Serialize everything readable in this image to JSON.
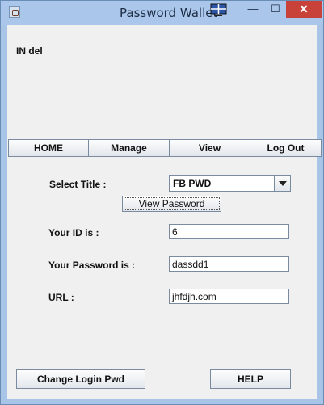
{
  "window": {
    "title": "Password Wallet",
    "controls": {
      "minimize": "—",
      "maximize": "☐",
      "close": "✕"
    }
  },
  "header": {
    "text": "IN del"
  },
  "menu": [
    {
      "label": "HOME"
    },
    {
      "label": "Manage"
    },
    {
      "label": "View"
    },
    {
      "label": "Log Out"
    }
  ],
  "form": {
    "select_title_label": "Select Title :",
    "select_title_value": "FB PWD",
    "view_password_button": "View Password",
    "id_label": "Your ID is :",
    "id_value": "6",
    "password_label": "Your Password is :",
    "password_value": "dassdd1",
    "url_label": "URL :",
    "url_value": "jhfdjh.com"
  },
  "footer": {
    "change_login_button": "Change Login Pwd",
    "help_button": "HELP"
  },
  "colors": {
    "titlebar": "#aac6ea",
    "close_button": "#c9423a",
    "client_background": "#f0f0f0"
  }
}
